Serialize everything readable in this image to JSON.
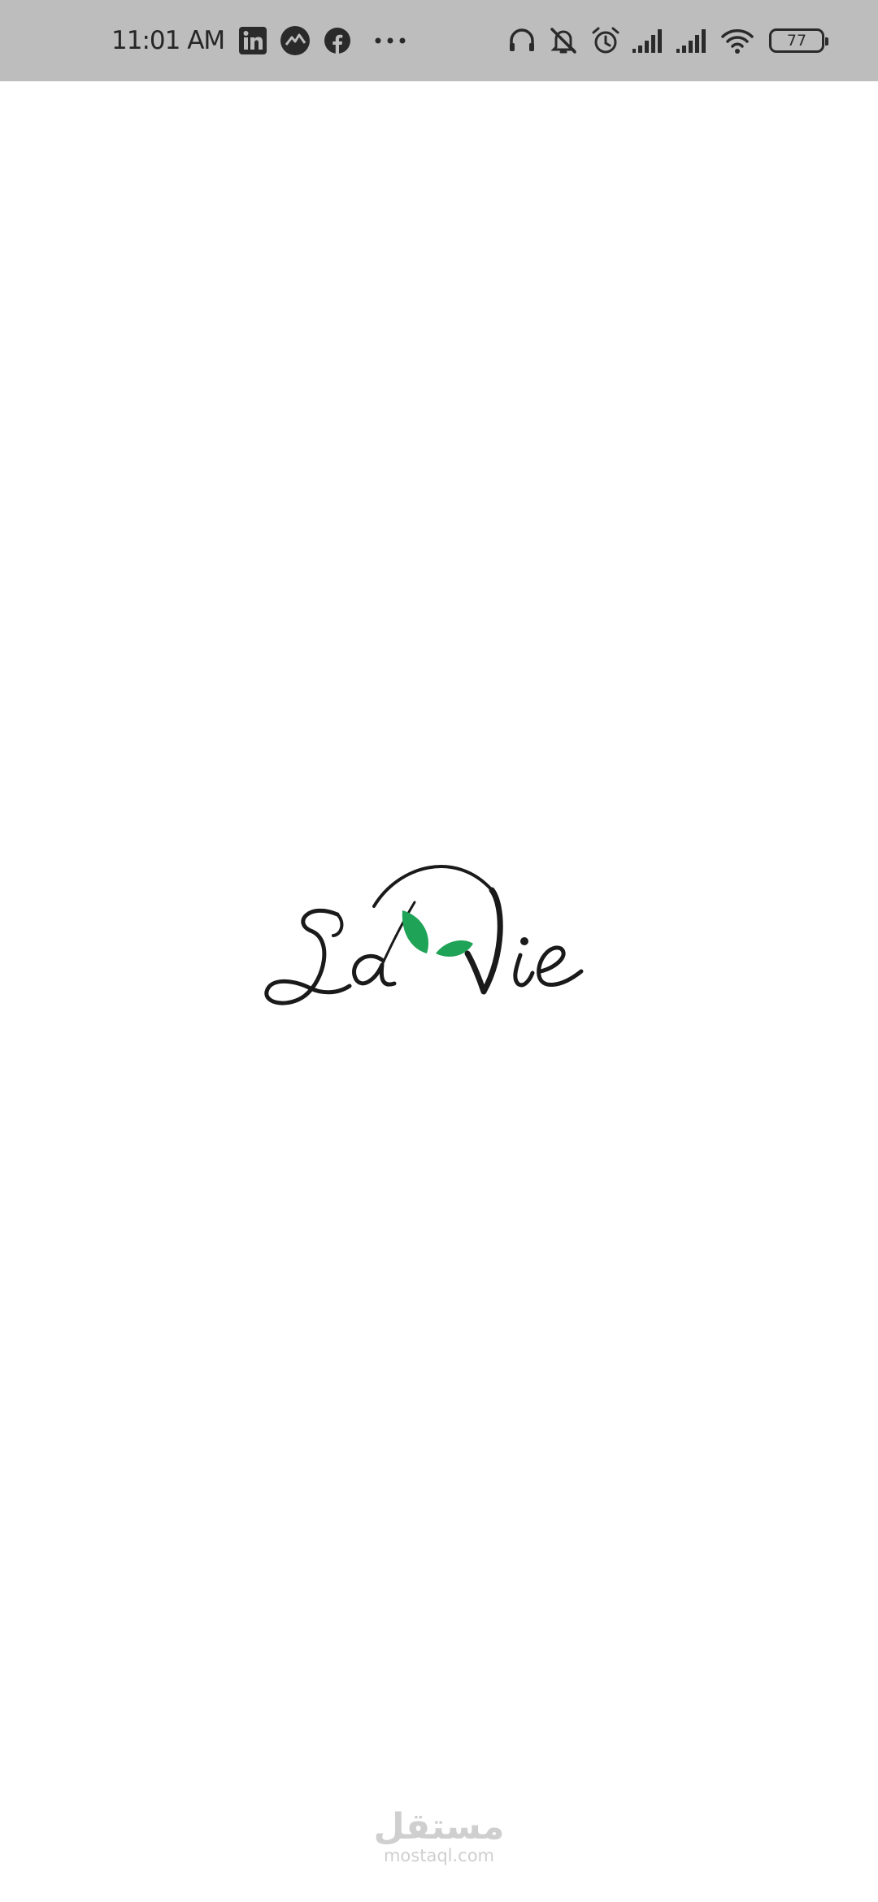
{
  "status_bar": {
    "time": "11:01 AM",
    "notification_icons": [
      "linkedin-icon",
      "app-notification-icon",
      "facebook-icon",
      "more-notifications-icon"
    ],
    "system_icons": [
      "headphones-icon",
      "notifications-muted-icon",
      "alarm-icon",
      "signal-sim1-icon",
      "signal-sim2-icon",
      "wifi-icon"
    ],
    "battery_level": "77"
  },
  "splash": {
    "logo_text": "La Vie",
    "leaf_color": "#1fa356",
    "logo_color": "#1a1a1a"
  },
  "watermark": {
    "arabic": "مستقل",
    "url": "mostaql.com"
  }
}
